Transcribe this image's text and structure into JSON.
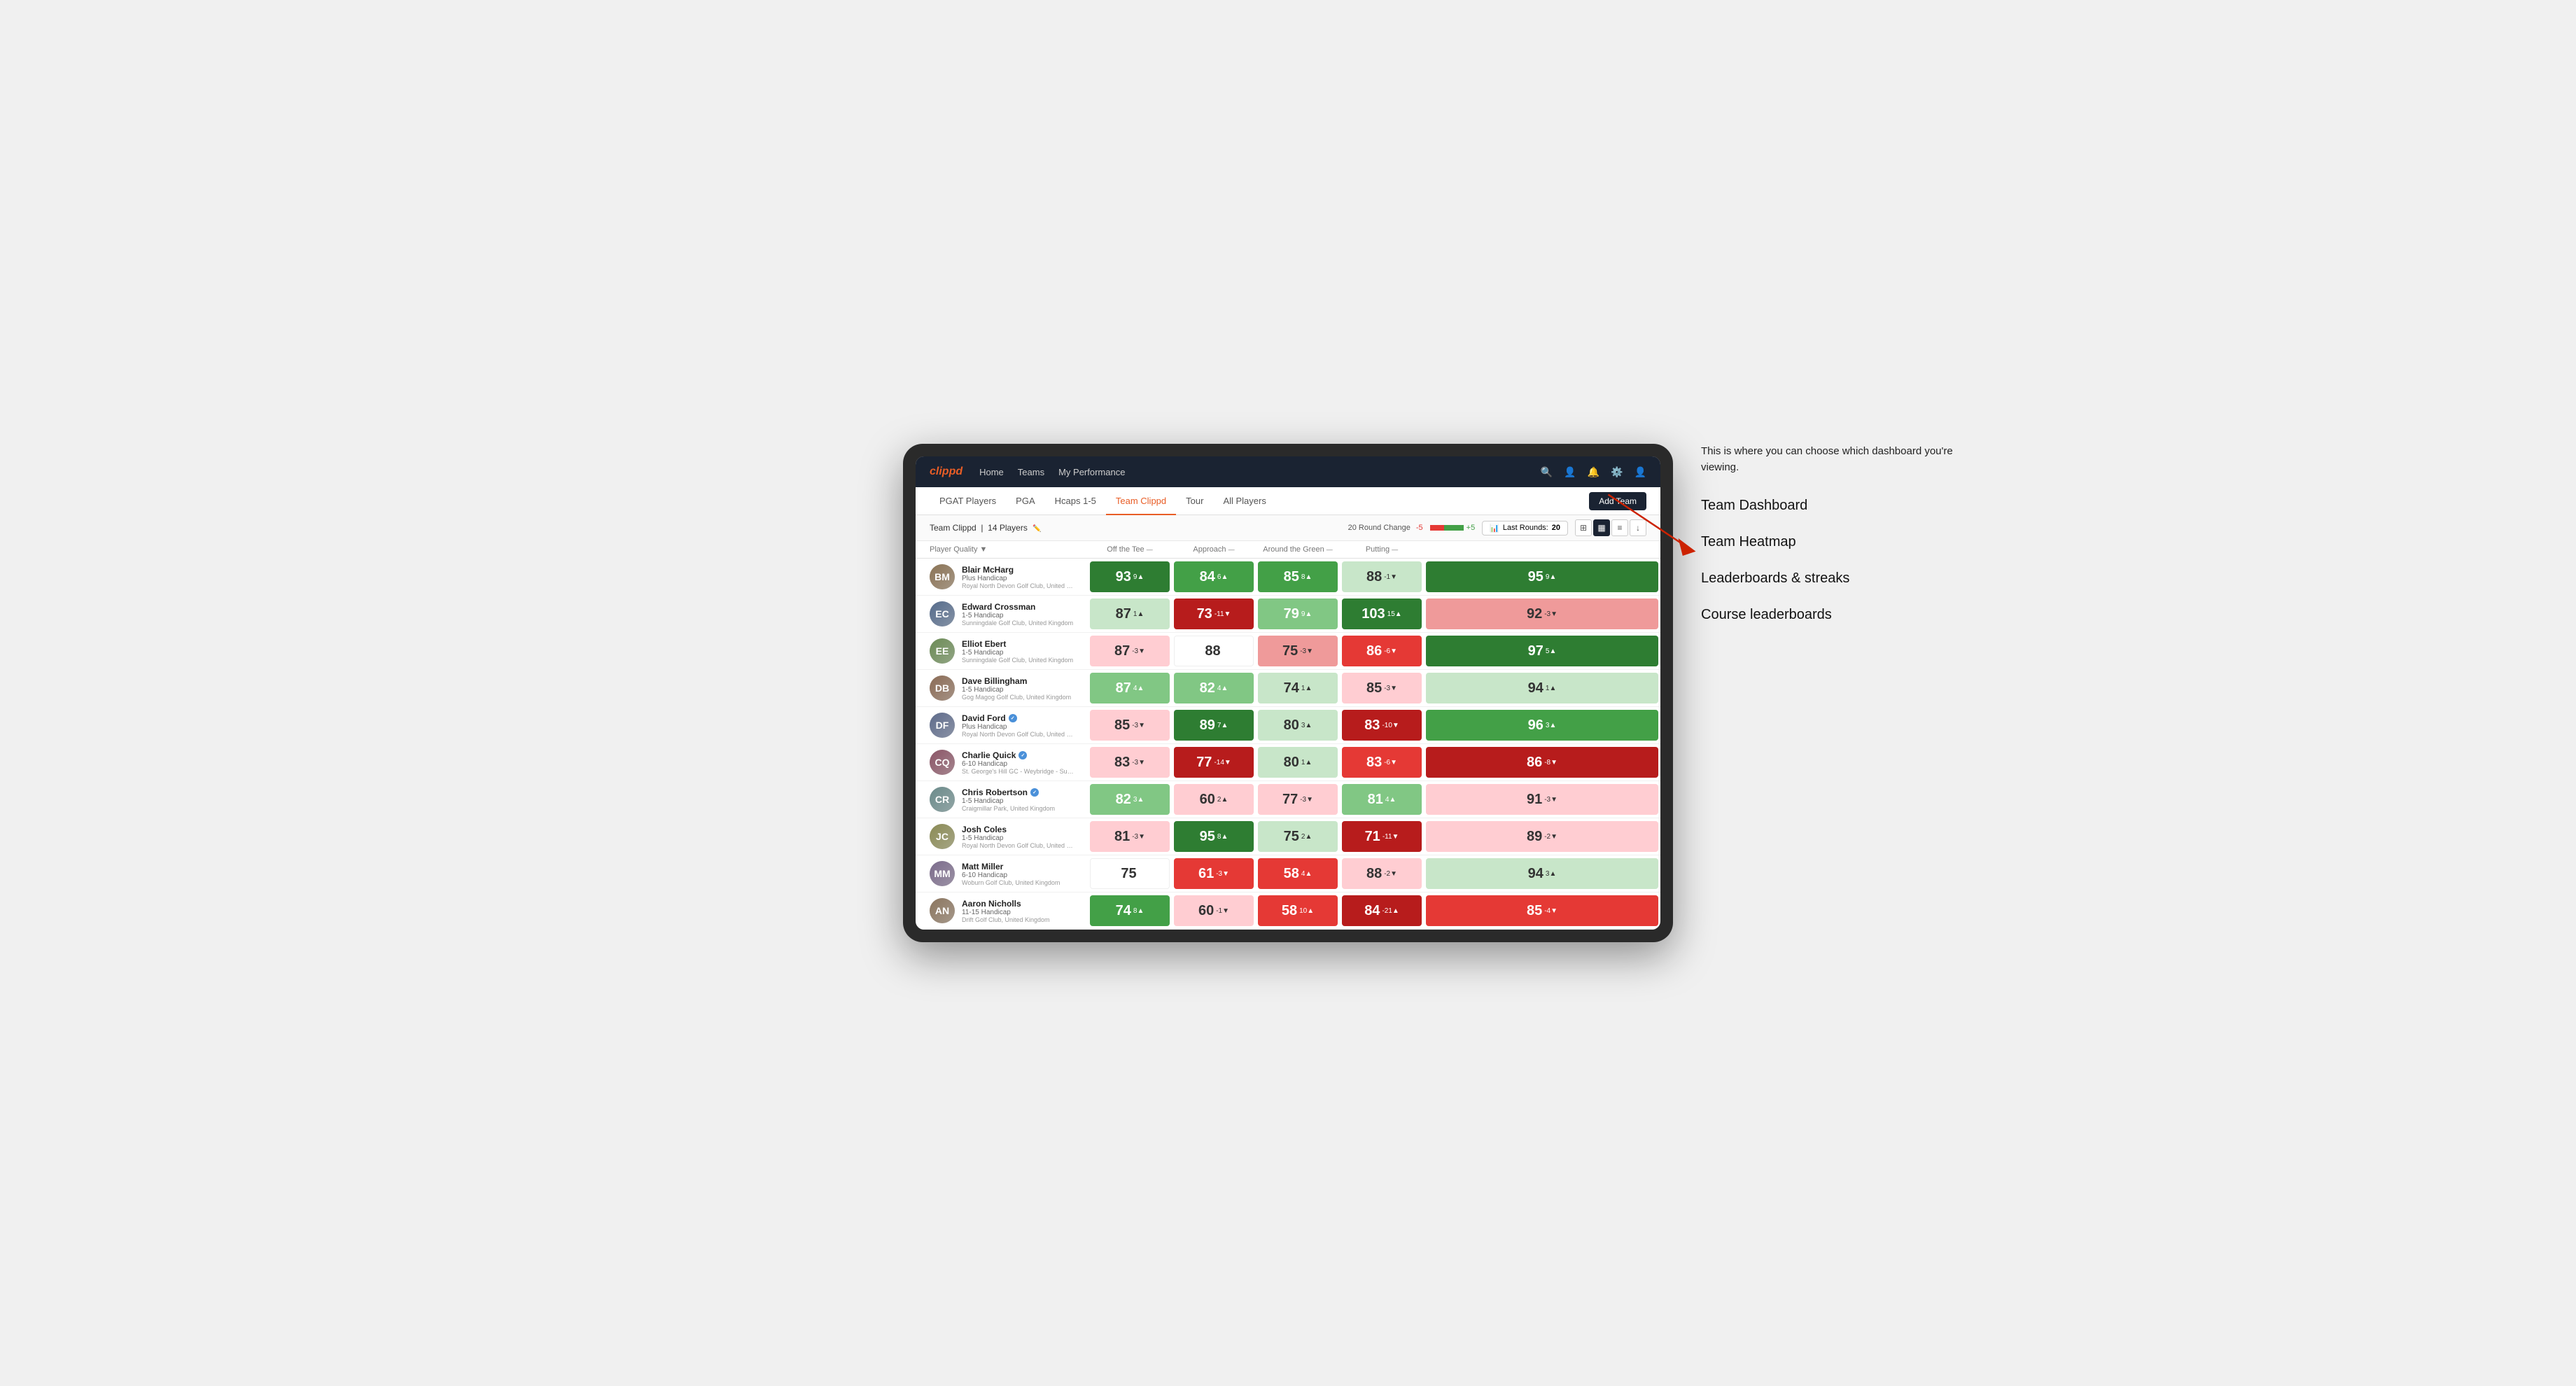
{
  "annotation": {
    "intro": "This is where you can choose which dashboard you're viewing.",
    "items": [
      "Team Dashboard",
      "Team Heatmap",
      "Leaderboards & streaks",
      "Course leaderboards"
    ]
  },
  "nav": {
    "logo": "clippd",
    "links": [
      "Home",
      "Teams",
      "My Performance"
    ],
    "icons": [
      "search",
      "person",
      "notifications",
      "settings",
      "user-avatar"
    ]
  },
  "sub_nav": {
    "links": [
      "PGAT Players",
      "PGA",
      "Hcaps 1-5",
      "Team Clippd",
      "Tour",
      "All Players"
    ],
    "active": "Team Clippd",
    "add_button": "Add Team"
  },
  "team_header": {
    "title": "Team Clippd",
    "player_count": "14 Players",
    "round_change_label": "20 Round Change",
    "round_change_value": "-5",
    "round_change_positive": "+5",
    "last_rounds_label": "Last Rounds:",
    "last_rounds_value": "20"
  },
  "table": {
    "columns": [
      {
        "label": "Player Quality",
        "key": "player_quality"
      },
      {
        "label": "Off the Tee",
        "key": "off_tee"
      },
      {
        "label": "Approach",
        "key": "approach"
      },
      {
        "label": "Around the Green",
        "key": "around_green"
      },
      {
        "label": "Putting",
        "key": "putting"
      }
    ],
    "rows": [
      {
        "name": "Blair McHarg",
        "handicap": "Plus Handicap",
        "club": "Royal North Devon Golf Club, United Kingdom",
        "verified": false,
        "initials": "BM",
        "scores": [
          {
            "value": "93",
            "change": "9▲",
            "color": "bg-green-strong"
          },
          {
            "value": "84",
            "change": "6▲",
            "color": "bg-green-medium"
          },
          {
            "value": "85",
            "change": "8▲",
            "color": "bg-green-medium"
          },
          {
            "value": "88",
            "change": "-1▼",
            "color": "bg-green-pale"
          },
          {
            "value": "95",
            "change": "9▲",
            "color": "bg-green-strong"
          }
        ]
      },
      {
        "name": "Edward Crossman",
        "handicap": "1-5 Handicap",
        "club": "Sunningdale Golf Club, United Kingdom",
        "verified": false,
        "initials": "EC",
        "scores": [
          {
            "value": "87",
            "change": "1▲",
            "color": "bg-green-pale"
          },
          {
            "value": "73",
            "change": "-11▼",
            "color": "bg-red-strong"
          },
          {
            "value": "79",
            "change": "9▲",
            "color": "bg-green-light"
          },
          {
            "value": "103",
            "change": "15▲",
            "color": "bg-green-strong"
          },
          {
            "value": "92",
            "change": "-3▼",
            "color": "bg-red-light"
          }
        ]
      },
      {
        "name": "Elliot Ebert",
        "handicap": "1-5 Handicap",
        "club": "Sunningdale Golf Club, United Kingdom",
        "verified": false,
        "initials": "EE",
        "scores": [
          {
            "value": "87",
            "change": "-3▼",
            "color": "bg-red-pale"
          },
          {
            "value": "88",
            "change": "",
            "color": "bg-white"
          },
          {
            "value": "75",
            "change": "-3▼",
            "color": "bg-red-light"
          },
          {
            "value": "86",
            "change": "-6▼",
            "color": "bg-red-medium"
          },
          {
            "value": "97",
            "change": "5▲",
            "color": "bg-green-strong"
          }
        ]
      },
      {
        "name": "Dave Billingham",
        "handicap": "1-5 Handicap",
        "club": "Gog Magog Golf Club, United Kingdom",
        "verified": false,
        "initials": "DB",
        "scores": [
          {
            "value": "87",
            "change": "4▲",
            "color": "bg-green-light"
          },
          {
            "value": "82",
            "change": "4▲",
            "color": "bg-green-light"
          },
          {
            "value": "74",
            "change": "1▲",
            "color": "bg-green-pale"
          },
          {
            "value": "85",
            "change": "-3▼",
            "color": "bg-red-pale"
          },
          {
            "value": "94",
            "change": "1▲",
            "color": "bg-green-pale"
          }
        ]
      },
      {
        "name": "David Ford",
        "handicap": "Plus Handicap",
        "club": "Royal North Devon Golf Club, United Kingdom",
        "verified": true,
        "initials": "DF",
        "scores": [
          {
            "value": "85",
            "change": "-3▼",
            "color": "bg-red-pale"
          },
          {
            "value": "89",
            "change": "7▲",
            "color": "bg-green-strong"
          },
          {
            "value": "80",
            "change": "3▲",
            "color": "bg-green-pale"
          },
          {
            "value": "83",
            "change": "-10▼",
            "color": "bg-red-strong"
          },
          {
            "value": "96",
            "change": "3▲",
            "color": "bg-green-medium"
          }
        ]
      },
      {
        "name": "Charlie Quick",
        "handicap": "6-10 Handicap",
        "club": "St. George's Hill GC - Weybridge - Surrey, Uni...",
        "verified": true,
        "initials": "CQ",
        "scores": [
          {
            "value": "83",
            "change": "-3▼",
            "color": "bg-red-pale"
          },
          {
            "value": "77",
            "change": "-14▼",
            "color": "bg-red-strong"
          },
          {
            "value": "80",
            "change": "1▲",
            "color": "bg-green-pale"
          },
          {
            "value": "83",
            "change": "-6▼",
            "color": "bg-red-medium"
          },
          {
            "value": "86",
            "change": "-8▼",
            "color": "bg-red-strong"
          }
        ]
      },
      {
        "name": "Chris Robertson",
        "handicap": "1-5 Handicap",
        "club": "Craigmillar Park, United Kingdom",
        "verified": true,
        "initials": "CR",
        "scores": [
          {
            "value": "82",
            "change": "3▲",
            "color": "bg-green-light"
          },
          {
            "value": "60",
            "change": "2▲",
            "color": "bg-red-pale"
          },
          {
            "value": "77",
            "change": "-3▼",
            "color": "bg-red-pale"
          },
          {
            "value": "81",
            "change": "4▲",
            "color": "bg-green-light"
          },
          {
            "value": "91",
            "change": "-3▼",
            "color": "bg-red-pale"
          }
        ]
      },
      {
        "name": "Josh Coles",
        "handicap": "1-5 Handicap",
        "club": "Royal North Devon Golf Club, United Kingdom",
        "verified": false,
        "initials": "JC",
        "scores": [
          {
            "value": "81",
            "change": "-3▼",
            "color": "bg-red-pale"
          },
          {
            "value": "95",
            "change": "8▲",
            "color": "bg-green-strong"
          },
          {
            "value": "75",
            "change": "2▲",
            "color": "bg-green-pale"
          },
          {
            "value": "71",
            "change": "-11▼",
            "color": "bg-red-strong"
          },
          {
            "value": "89",
            "change": "-2▼",
            "color": "bg-red-pale"
          }
        ]
      },
      {
        "name": "Matt Miller",
        "handicap": "6-10 Handicap",
        "club": "Woburn Golf Club, United Kingdom",
        "verified": false,
        "initials": "MM",
        "scores": [
          {
            "value": "75",
            "change": "",
            "color": "bg-white"
          },
          {
            "value": "61",
            "change": "-3▼",
            "color": "bg-red-medium"
          },
          {
            "value": "58",
            "change": "4▲",
            "color": "bg-red-medium"
          },
          {
            "value": "88",
            "change": "-2▼",
            "color": "bg-red-pale"
          },
          {
            "value": "94",
            "change": "3▲",
            "color": "bg-green-pale"
          }
        ]
      },
      {
        "name": "Aaron Nicholls",
        "handicap": "11-15 Handicap",
        "club": "Drift Golf Club, United Kingdom",
        "verified": false,
        "initials": "AN",
        "scores": [
          {
            "value": "74",
            "change": "8▲",
            "color": "bg-green-medium"
          },
          {
            "value": "60",
            "change": "-1▼",
            "color": "bg-red-pale"
          },
          {
            "value": "58",
            "change": "10▲",
            "color": "bg-red-medium"
          },
          {
            "value": "84",
            "change": "-21▲",
            "color": "bg-red-strong"
          },
          {
            "value": "85",
            "change": "-4▼",
            "color": "bg-red-medium"
          }
        ]
      }
    ]
  }
}
